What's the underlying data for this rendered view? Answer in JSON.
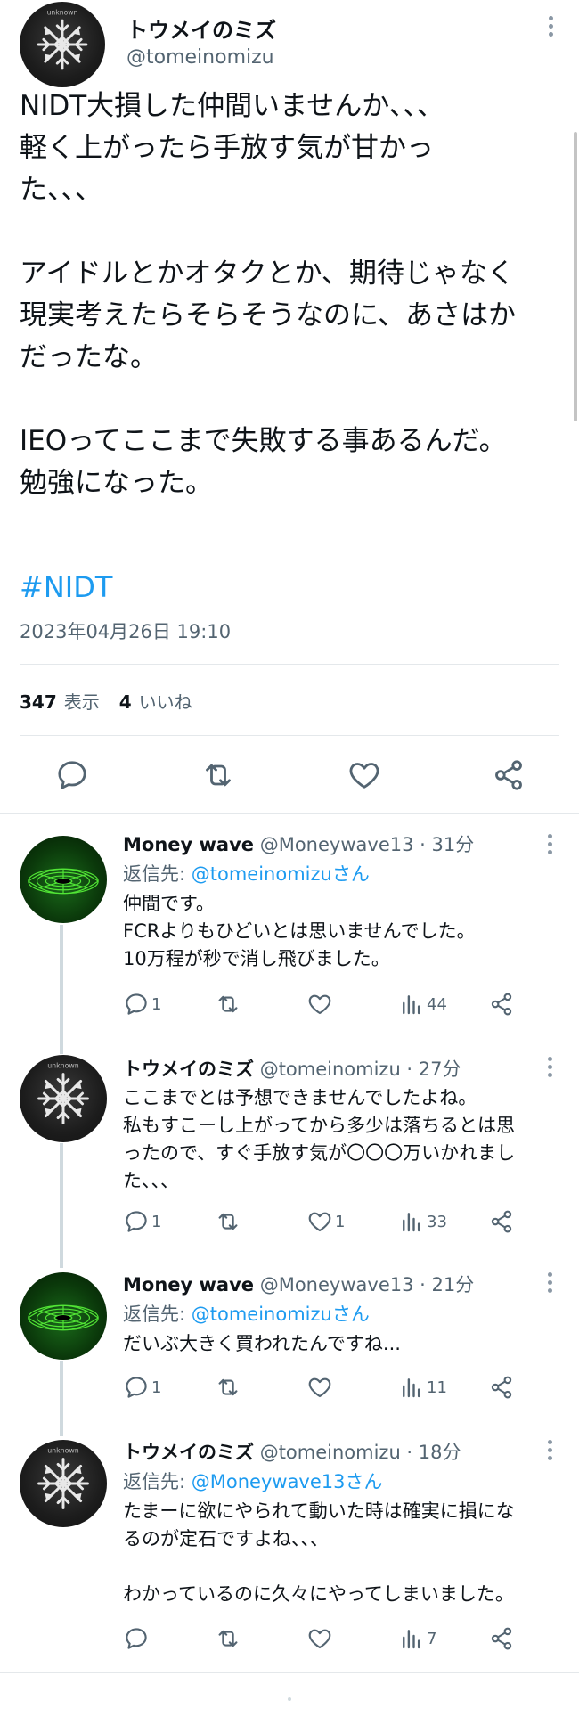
{
  "main_tweet": {
    "author_name": "トウメイのミズ",
    "author_handle": "@tomeinomizu",
    "avatar_text": "unknown",
    "text": "NIDT大損した仲間いませんか、、、\n軽く上がったら手放す気が甘かっ\nた、、、\n\nアイドルとかオタクとか、期待じゃなく\n現実考えたらそらそうなのに、あさはか\nだったな。\n\nIEOってここまで失敗する事あるんだ。\n勉強になった。",
    "hashtag": "#NIDT",
    "datetime": "2023年04月26日 19:10",
    "views_count": "347",
    "views_label": "表示",
    "likes_count": "4",
    "likes_label": "いいね"
  },
  "replies": [
    {
      "author_name": "Money wave",
      "meta": "@Moneywave13 · 31分",
      "reply_to_label": "返信先: ",
      "reply_to_link": "@tomeinomizuさん",
      "text": "仲間です。\nFCRよりもひどいとは思いませんでした。\n10万程が秒で消し飛びました。",
      "reply_count": "1",
      "retweet_count": "",
      "like_count": "",
      "view_count": "44"
    },
    {
      "author_name": "トウメイのミズ",
      "meta": "@tomeinomizu · 27分",
      "text": "ここまでとは予想できませんでしたよね。\n私もすこーし上がってから多少は落ちるとは思\nったので、すぐ手放す気が〇〇〇万いかれまし\nた、、、",
      "reply_count": "1",
      "retweet_count": "",
      "like_count": "1",
      "view_count": "33"
    },
    {
      "author_name": "Money wave",
      "meta": "@Moneywave13 · 21分",
      "reply_to_label": "返信先: ",
      "reply_to_link": "@tomeinomizuさん",
      "text": "だいぶ大きく買われたんですね...",
      "reply_count": "1",
      "retweet_count": "",
      "like_count": "",
      "view_count": "11"
    },
    {
      "author_name": "トウメイのミズ",
      "meta": "@tomeinomizu · 18分",
      "reply_to_label": "返信先: ",
      "reply_to_link": "@Moneywave13さん",
      "text": "たまーに欲にやられて動いた時は確実に損にな\nるのが定石ですよね、、、\n\nわかっているのに久々にやってしまいました。",
      "reply_count": "",
      "retweet_count": "",
      "like_count": "",
      "view_count": "7"
    }
  ],
  "colors": {
    "text": "#0f1419",
    "secondary": "#536471",
    "accent": "#1d9bf0",
    "divider": "#e4e8eb",
    "thread_line": "#cfd9de"
  },
  "icons": {
    "reply": "reply-icon",
    "retweet": "retweet-icon",
    "like": "heart-icon",
    "views": "views-icon",
    "share": "share-icon",
    "more": "more-icon"
  }
}
